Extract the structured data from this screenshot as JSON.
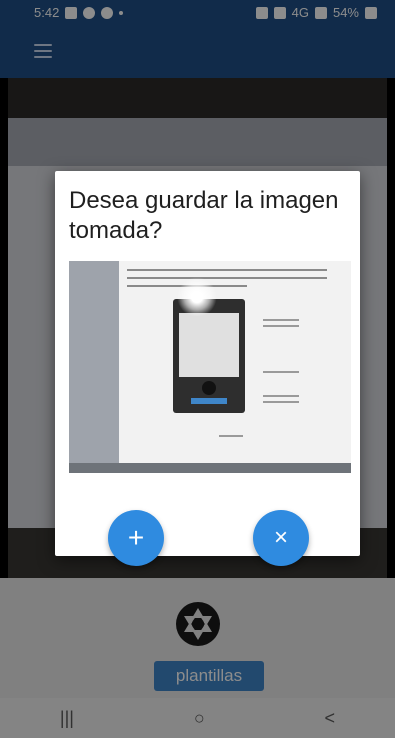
{
  "status_bar": {
    "time": "5:42",
    "network": "4G",
    "battery": "54%"
  },
  "appbar": {
    "menu_icon": "hamburger-menu-icon"
  },
  "dialog": {
    "title": "Desea guardar la imagen tomada?",
    "add_button": "+",
    "close_button": "×"
  },
  "bottom": {
    "camera_icon": "camera-shutter-icon",
    "template_button": "plantillas"
  },
  "nav": {
    "recents": "|||",
    "home": "○",
    "back": "<"
  },
  "colors": {
    "appbar": "#1f4f87",
    "fab": "#2f8be0",
    "template_button": "#3f86c9"
  }
}
